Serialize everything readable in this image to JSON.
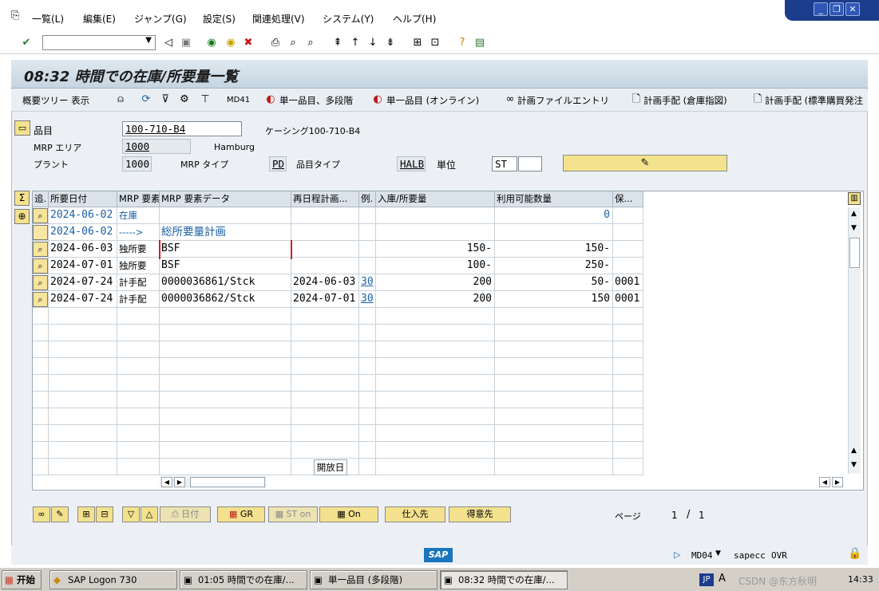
{
  "menu": [
    "一覧(L)",
    "編集(E)",
    "ジャンプ(G)",
    "設定(S)",
    "関連処理(V)",
    "システム(Y)",
    "ヘルプ(H)"
  ],
  "title": "08:32 時間での在庫/所要量一覧",
  "app_toolbar": {
    "tree": "概要ツリー 表示",
    "md41": "MD41",
    "single_multi": "単一品目、多段階",
    "single_online": "単一品目 (オンライン)",
    "plan_file": "計画ファイルエントリ",
    "plan_order_wh": "計画手配 (倉庫指図)",
    "plan_order_std": "計画手配 (標準購買発注"
  },
  "header": {
    "material_label": "品目",
    "material": "100-710-B4",
    "material_desc": "ケーシング100-710-B4",
    "mrp_area_label": "MRP エリア",
    "mrp_area": "1000",
    "mrp_area_desc": "Hamburg",
    "plant_label": "プラント",
    "plant": "1000",
    "mrp_type_label": "MRP タイプ",
    "mrp_type": "PD",
    "mat_type_label": "品目タイプ",
    "mat_type": "HALB",
    "unit_label": "単位",
    "unit": "ST"
  },
  "grid": {
    "columns": [
      "追.",
      "所要日付",
      "MRP 要素",
      "MRP 要素データ",
      "再日程計画...",
      "例.",
      "入庫/所要量",
      "利用可能数量",
      "保..."
    ],
    "rows": [
      {
        "date": "2024-06-02",
        "elem": "在庫",
        "data": "",
        "resched": "",
        "ex": "",
        "qty": "",
        "avail": "0",
        "sto": ""
      },
      {
        "date": "2024-06-02",
        "elem": "----->",
        "data": "総所要量計画",
        "resched": "",
        "ex": "",
        "qty": "",
        "avail": "",
        "sto": ""
      },
      {
        "date": "2024-06-03",
        "elem": "独所要",
        "data": "BSF",
        "resched": "",
        "ex": "",
        "qty": "150-",
        "avail": "150-",
        "sto": ""
      },
      {
        "date": "2024-07-01",
        "elem": "独所要",
        "data": "BSF",
        "resched": "",
        "ex": "",
        "qty": "100-",
        "avail": "250-",
        "sto": ""
      },
      {
        "date": "2024-07-24",
        "elem": "計手配",
        "data": "0000036861/Stck",
        "resched": "2024-06-03",
        "ex": "30",
        "qty": "200",
        "avail": "50-",
        "sto": "0001"
      },
      {
        "date": "2024-07-24",
        "elem": "計手配",
        "data": "0000036862/Stck",
        "resched": "2024-07-01",
        "ex": "30",
        "qty": "200",
        "avail": "150",
        "sto": "0001"
      }
    ],
    "tooltip": "開放日"
  },
  "bottom": {
    "date_btn": "日付",
    "gr_btn": "GR",
    "st_btn": "ST on",
    "on_btn": "On",
    "vendor_btn": "仕入先",
    "customer_btn": "得意先",
    "page_label": "ページ",
    "page_current": "1",
    "page_sep": "/",
    "page_total": "1"
  },
  "status": {
    "brand": "SAP",
    "tcode": "MD04",
    "server": "sapecc",
    "mode": "OVR"
  },
  "taskbar": {
    "start": "开始",
    "tasks": [
      "SAP Logon 730",
      "01:05 時間での在庫/...",
      "単一品目 (多段階)",
      "08:32 時間での在庫/..."
    ],
    "lang": "JP",
    "clock": "14:33",
    "watermark": "CSDN @东方秋明"
  }
}
